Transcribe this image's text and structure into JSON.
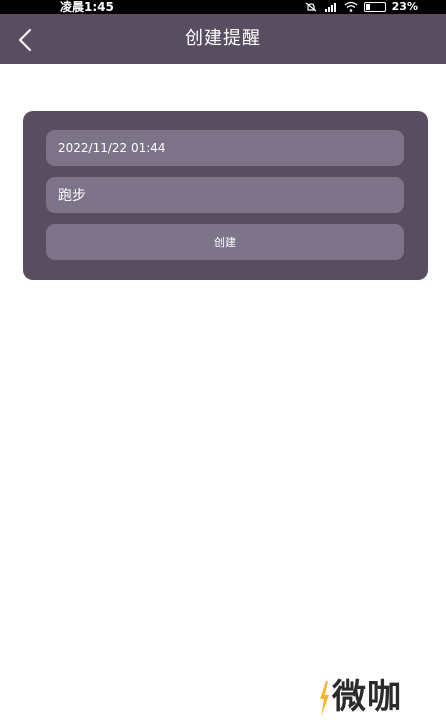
{
  "status_bar": {
    "time": "凌晨1:45",
    "battery": "23%"
  },
  "header": {
    "title": "创建提醒"
  },
  "form": {
    "datetime_value": "2022/11/22 01:44",
    "title_value": "跑步",
    "create_label": "创建"
  },
  "watermark": {
    "text": "微咖"
  },
  "colors": {
    "header_bg": "#584d61",
    "card_bg": "#584d61",
    "field_bg": "#7d7489",
    "watermark_accent": "#f5b82e"
  },
  "icons": {
    "back": "chevron-left-icon",
    "mute": "bell-off-icon",
    "signal": "signal-icon",
    "wifi": "wifi-icon",
    "battery": "battery-icon"
  }
}
